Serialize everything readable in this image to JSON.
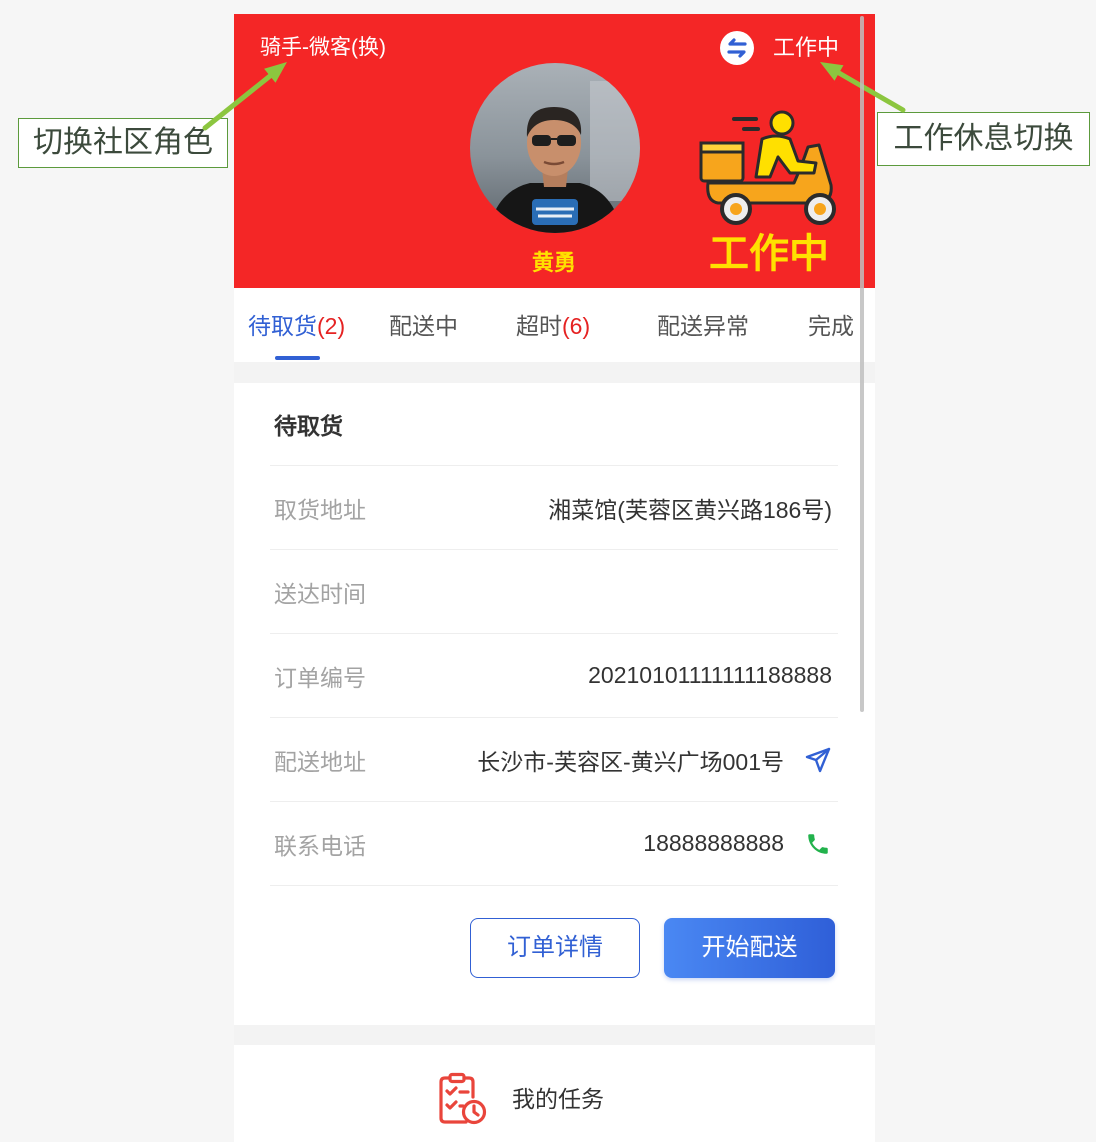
{
  "annotations": {
    "role_switch": "切换社区角色",
    "work_rest_switch": "工作休息切换"
  },
  "header": {
    "role_label": "骑手-微客(换)",
    "status_label": "工作中",
    "user_name": "黄勇",
    "status_banner": "工作中"
  },
  "tabs": [
    {
      "label": "待取货",
      "count": "(2)",
      "active": true
    },
    {
      "label": "配送中"
    },
    {
      "label": "超时",
      "count": "(6)"
    },
    {
      "label": "配送异常"
    },
    {
      "label": "完成"
    }
  ],
  "order_card": {
    "title": "待取货",
    "rows": [
      {
        "label": "取货地址",
        "value": "湘菜馆(芙蓉区黄兴路186号)"
      },
      {
        "label": "送达时间",
        "value": ""
      },
      {
        "label": "订单编号",
        "value": "20210101111111188888"
      },
      {
        "label": "配送地址",
        "value": "长沙市-芙容区-黄兴广场001号",
        "icon": "paper-plane-icon"
      },
      {
        "label": "联系电话",
        "value": "18888888888",
        "icon": "phone-icon"
      }
    ],
    "buttons": {
      "order_detail": "订单详情",
      "start_delivery": "开始配送"
    }
  },
  "footer": {
    "my_tasks_label": "我的任务",
    "my_tasks_icon": "task-clipboard-icon"
  },
  "icons": {
    "status_toggle": "swap-icon",
    "avatar": "user-avatar-photo",
    "illustration": "delivery-scooter-illustration"
  },
  "colors": {
    "header-red": "#f42626",
    "accent-blue": "#3160d4",
    "count-red": "#e52222",
    "banner-yellow": "#ffe100",
    "phone-green": "#22b24c",
    "task-red": "#e9453b",
    "annotation-green": "#8cc63f"
  }
}
